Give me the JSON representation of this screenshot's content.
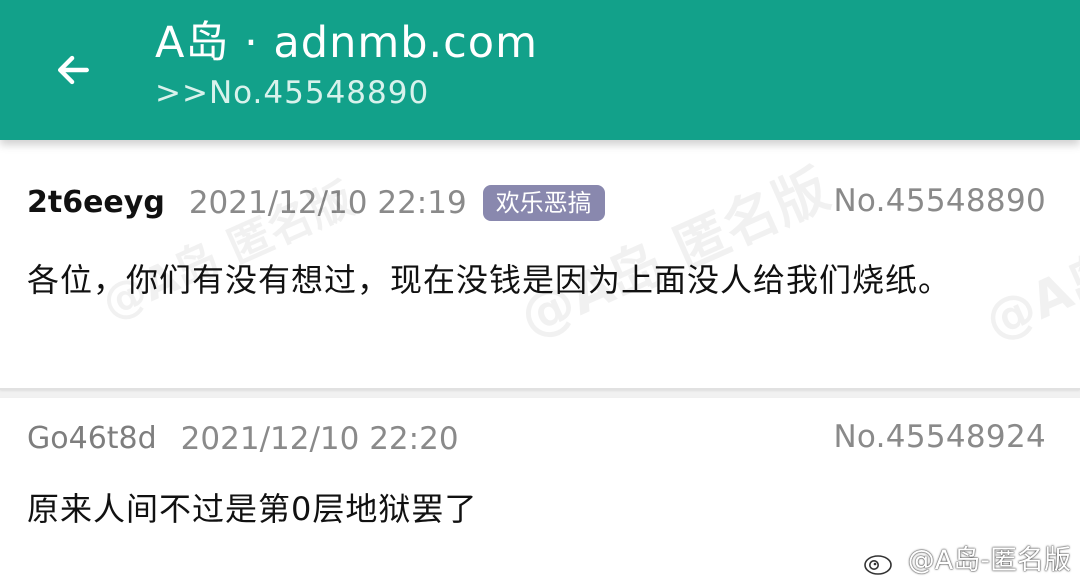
{
  "header": {
    "title": "A岛 · adnmb.com",
    "subtitle": ">>No.45548890"
  },
  "icons": {
    "back": "back-arrow-icon",
    "watermark": "weibo-icon"
  },
  "colors": {
    "header": "#12a18a",
    "tag": "#8988ae",
    "divider_accent": "#40a84a"
  },
  "watermark": {
    "text": "@A岛-匿名版",
    "faint_text": "@A岛 匿名版",
    "partial_text": "@A岛"
  },
  "posts": [
    {
      "user": "2t6eeyg",
      "time": "2021/12/10 22:19",
      "tag": "欢乐恶搞",
      "no": "No.45548890",
      "content": "各位，你们有没有想过，现在没钱是因为上面没人给我们烧纸。"
    },
    {
      "user": "Go46t8d",
      "time": "2021/12/10 22:20",
      "no": "No.45548924",
      "content": "原来人间不过是第0层地狱罢了"
    }
  ]
}
